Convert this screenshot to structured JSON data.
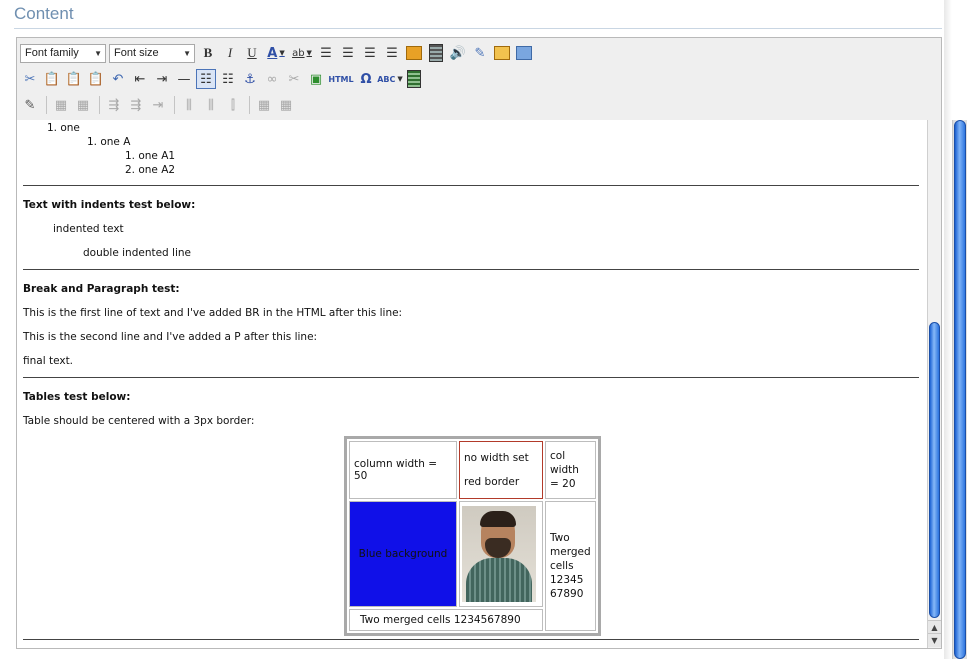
{
  "page": {
    "section_title": "Content"
  },
  "toolbar": {
    "font_family": "Font family",
    "font_size": "Font size",
    "bold": "B",
    "italic": "I",
    "underline": "U",
    "font_color": "A",
    "highlight": "ab",
    "html_label": "HTML",
    "omega": "Ω",
    "spell": "ABC"
  },
  "content": {
    "list": {
      "l1": "1.  one",
      "l2": "1.  one A",
      "l3a": "1.  one A1",
      "l3b": "2.  one A2"
    },
    "indent_heading": "Text with indents test below:",
    "indented": "indented text",
    "double_indented": "double indented line",
    "break_heading": "Break and Paragraph test:",
    "line1": "This is the first line of text and I've added BR in the HTML after this line:",
    "line2": "This is the second line and I've added a P after this line:",
    "final": "final text.",
    "tables_heading": "Tables test below:",
    "tables_note": "Table should be centered with a 3px border:",
    "table": {
      "col_width_50": "column width = 50",
      "no_width_1": "no width set",
      "no_width_2": "red border",
      "col_width_20": [
        "col",
        "width",
        "= 20"
      ],
      "blue_bg": "Blue background",
      "merged_right": [
        "Two",
        "merged",
        "cells",
        "12345",
        "67890"
      ],
      "merged_bottom": "Two merged cells 1234567890"
    }
  },
  "colors": {
    "title": "#6f8fb0",
    "blue_cell": "#1010e8",
    "red_border": "#b23a2a",
    "scroll_thumb": "#2f76e0"
  }
}
